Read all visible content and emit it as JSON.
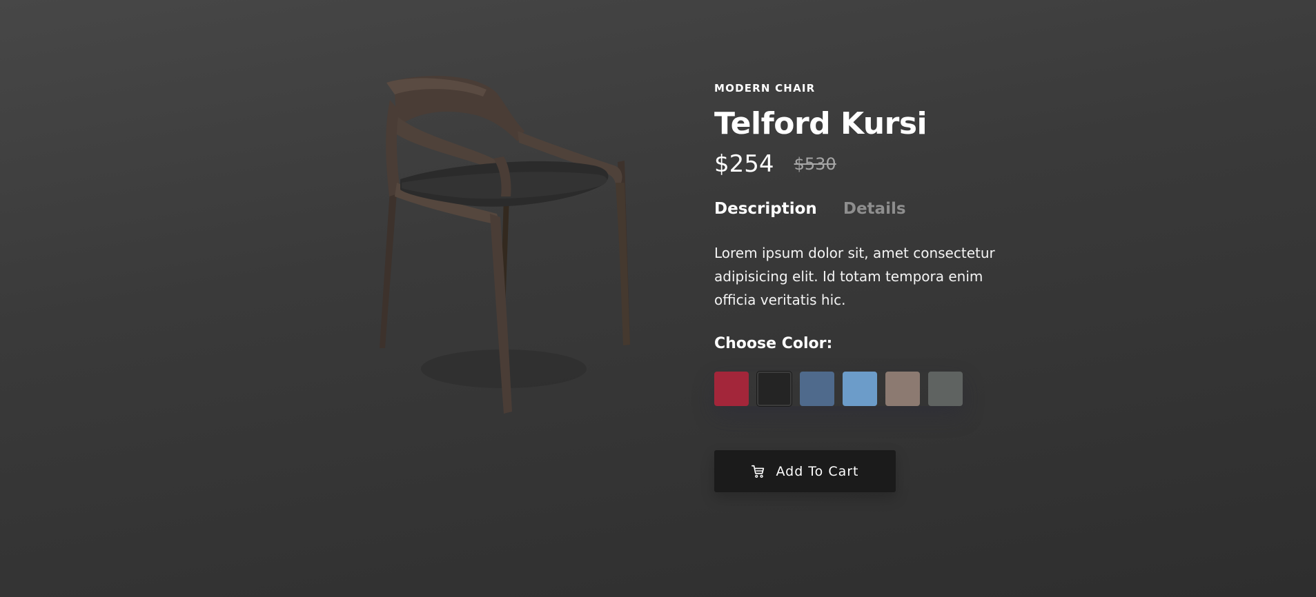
{
  "product": {
    "category": "MODERN CHAIR",
    "title": "Telford Kursi",
    "price_current": "$254",
    "price_old": "$530",
    "tabs": [
      {
        "label": "Description",
        "active": true
      },
      {
        "label": "Details",
        "active": false
      }
    ],
    "description": "Lorem ipsum dolor sit, amet consectetur adipisicing elit. Id totam tempora enim officia veritatis hic.",
    "color_label": "Choose Color:",
    "colors": [
      {
        "name": "red",
        "hex": "#a3263a",
        "selected": false
      },
      {
        "name": "black",
        "hex": "#242424",
        "selected": true
      },
      {
        "name": "denim",
        "hex": "#4f6a8c",
        "selected": false
      },
      {
        "name": "light-blue",
        "hex": "#6c9cc9",
        "selected": false
      },
      {
        "name": "beige",
        "hex": "#8c7a71",
        "selected": false
      },
      {
        "name": "grey",
        "hex": "#5f6361",
        "selected": false
      }
    ],
    "cart_button_label": "Add To Cart",
    "cart_icon": "cart-icon"
  },
  "theme": {
    "background": "#3c3c3c",
    "button_bg": "#1b1b1b",
    "inactive_tab": "#8e8e8e",
    "old_price": "#a6a6a6",
    "chair_wood": "#4a3d36",
    "chair_seat": "#2a2a2a"
  }
}
